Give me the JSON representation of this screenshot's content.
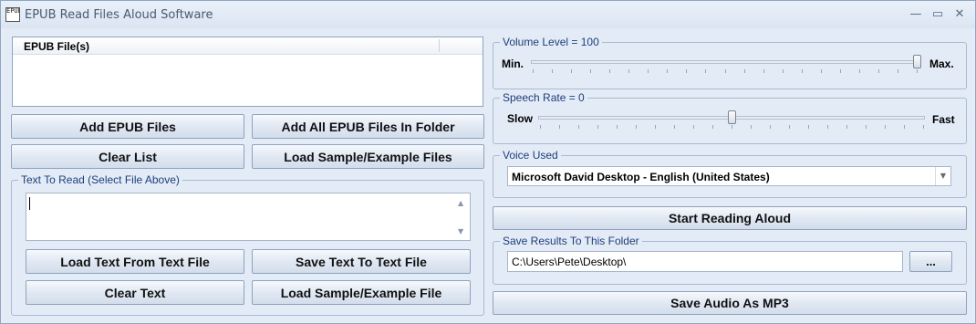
{
  "window": {
    "title": "EPUB Read Files Aloud Software",
    "icon_text": "EPUB",
    "minimize_glyph": "—",
    "maximize_glyph": "▭",
    "close_glyph": "✕"
  },
  "file_list": {
    "header": "EPUB File(s)"
  },
  "buttons": {
    "add_files": "Add EPUB Files",
    "add_folder": "Add All EPUB Files In Folder",
    "clear_list": "Clear List",
    "load_sample_files": "Load Sample/Example Files",
    "load_text": "Load Text From Text File",
    "save_text": "Save Text To Text File",
    "clear_text": "Clear Text",
    "load_sample_file": "Load Sample/Example File",
    "start_reading": "Start Reading Aloud",
    "browse": "...",
    "save_mp3": "Save Audio As MP3"
  },
  "text_group": {
    "label": "Text To Read (Select File Above)",
    "value": ""
  },
  "volume": {
    "label": "Volume Level = 100",
    "min_label": "Min.",
    "max_label": "Max.",
    "value": 100,
    "min": 0,
    "max": 100
  },
  "speech_rate": {
    "label": "Speech Rate = 0",
    "slow_label": "Slow",
    "fast_label": "Fast",
    "value": 0,
    "min": -10,
    "max": 10
  },
  "voice": {
    "label": "Voice Used",
    "selected": "Microsoft David Desktop - English (United States)"
  },
  "save_folder": {
    "label": "Save Results To This Folder",
    "path": "C:\\Users\\Pete\\Desktop\\"
  },
  "icons": {
    "app": "epub-app-icon",
    "dropdown": "chevron-down-icon",
    "scroll_up": "scroll-up-icon",
    "scroll_down": "scroll-down-icon"
  },
  "colors": {
    "group_label": "#1d3f7a",
    "background": "#e3ebf6"
  }
}
